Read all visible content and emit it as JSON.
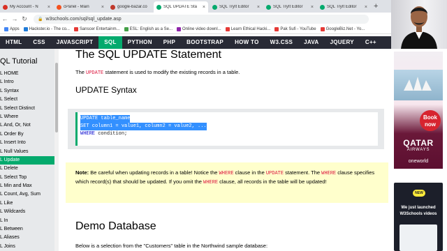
{
  "tabs": [
    {
      "label": "My Account - N",
      "color": "#d93025",
      "active": false
    },
    {
      "label": "cPanel - Main",
      "color": "#f4511e",
      "active": false
    },
    {
      "label": "google-bazar.co",
      "color": "#c0392b",
      "active": false
    },
    {
      "label": "SQL UPDATE Sta",
      "color": "#04aa6d",
      "active": true
    },
    {
      "label": "SQL TryIt Editor",
      "color": "#04aa6d",
      "active": false
    },
    {
      "label": "SQL TryIt Editor",
      "color": "#04aa6d",
      "active": false
    },
    {
      "label": "SQL TryIt Editor",
      "color": "#04aa6d",
      "active": false
    }
  ],
  "address": "w3schools.com/sql/sql_update.asp",
  "bookmarks": [
    {
      "label": "Apps",
      "color": "#4285f4"
    },
    {
      "label": "Hackster.io - The co...",
      "color": "#1f7bd8"
    },
    {
      "label": "Sanscer Entertainm...",
      "color": "#e53935"
    },
    {
      "label": "ESL: English as a Se...",
      "color": "#43a047"
    },
    {
      "label": "Online video downl...",
      "color": "#8e24aa"
    },
    {
      "label": "Learn Ethical Hacki...",
      "color": "#e53935"
    },
    {
      "label": "Pak Sufi - YouTube",
      "color": "#e53935"
    },
    {
      "label": "GoogleBiz.Net - Yo...",
      "color": "#e53935"
    }
  ],
  "topnav": [
    "HTML",
    "CSS",
    "JAVASCRIPT",
    "SQL",
    "PYTHON",
    "PHP",
    "BOOTSTRAP",
    "HOW TO",
    "W3.CSS",
    "JAVA",
    "JQUERY",
    "C++"
  ],
  "topnav_active": "SQL",
  "sidebar": {
    "title": "QL Tutorial",
    "items": [
      "L HOME",
      "L Intro",
      "L Syntax",
      "L Select",
      "L Select Distinct",
      "L Where",
      "L And, Or, Not",
      "L Order By",
      "L Insert Into",
      "L Null Values",
      "L Update",
      "L Delete",
      "L Select Top",
      "L Min and Max",
      "L Count, Avg, Sum",
      "L Like",
      "L Wildcards",
      "L In",
      "L Between",
      "L Aliases",
      "L Joins"
    ],
    "active": "L Update"
  },
  "main": {
    "title": "The SQL UPDATE Statement",
    "intro_pre": "The ",
    "intro_kw": "UPDATE",
    "intro_post": " statement is used to modify the existing records in a table.",
    "syntax_heading": "UPDATE Syntax",
    "code": {
      "l1_kw": "UPDATE",
      "l1_rest": " table_name",
      "l2_kw": "SET",
      "l2_rest": " column1 = value1, column2 = value2, ...",
      "l3_kw": "WHERE",
      "l3_rest": " condition;"
    },
    "note": {
      "bold": "Note:",
      "t1": " Be careful when updating records in a table! Notice the ",
      "k1": "WHERE",
      "t2": " clause in the ",
      "k2": "UPDATE",
      "t3": " statement. The ",
      "k3": "WHERE",
      "t4": " clause specifies which record(s) that should be updated. If you omit the ",
      "k4": "WHERE",
      "t5": " clause, all records in the table will be updated!"
    },
    "demo_heading": "Demo Database",
    "demo_text": "Below is a selection from the \"Customers\" table in the Northwind sample database:"
  },
  "ad": {
    "book_line1": "Book",
    "book_line2": "now",
    "airline": "QATAR",
    "airline_sub": "AIRWAYS",
    "alliance": "oneworld"
  },
  "promo": {
    "badge": "NEW",
    "text": "We just launched W3Schools videos"
  }
}
